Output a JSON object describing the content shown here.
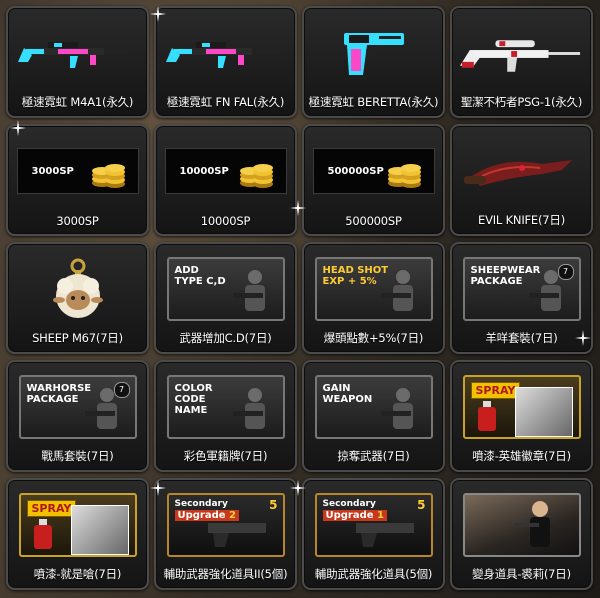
{
  "items": [
    {
      "label": "極速霓虹 M4A1(永久)",
      "art": "rifle-neon"
    },
    {
      "label": "極速霓虹 FN FAL(永久)",
      "art": "rifle-neon"
    },
    {
      "label": "極速霓虹 BERETTA(永久)",
      "art": "pistol-neon"
    },
    {
      "label": "聖潔不朽者PSG-1(永久)",
      "art": "sniper-white"
    },
    {
      "label": "3000SP",
      "art": "sp",
      "amount": "3000SP"
    },
    {
      "label": "10000SP",
      "art": "sp",
      "amount": "10000SP"
    },
    {
      "label": "500000SP",
      "art": "sp",
      "amount": "500000SP"
    },
    {
      "label": "EVIL KNIFE(7日)",
      "art": "knife"
    },
    {
      "label": "SHEEP M67(7日)",
      "art": "sheep"
    },
    {
      "label": "武器增加C.D(7日)",
      "art": "promo",
      "promo_text": "ADD\nTYPE C,D",
      "promo_color": "#ffffff"
    },
    {
      "label": "爆頭點數+5%(7日)",
      "art": "promo",
      "promo_text": "HEAD SHOT\nEXP + 5%",
      "promo_color": "#ffcc33"
    },
    {
      "label": "羊咩套裝(7日)",
      "art": "promo",
      "promo_text": "SHEEPWEAR\nPACKAGE",
      "promo_color": "#ffffff",
      "badge": "7"
    },
    {
      "label": "戰馬套裝(7日)",
      "art": "promo",
      "promo_text": "WARHORSE\nPACKAGE",
      "promo_color": "#ffffff",
      "badge": "7"
    },
    {
      "label": "彩色軍籍牌(7日)",
      "art": "promo",
      "promo_text": "COLOR\nCODE\nNAME",
      "promo_color": "#ffffff"
    },
    {
      "label": "掠奪武器(7日)",
      "art": "promo",
      "promo_text": "GAIN\nWEAPON",
      "promo_color": "#ffffff"
    },
    {
      "label": "噴漆-英雄徽章(7日)",
      "art": "spray",
      "promo_text": "SPRAY"
    },
    {
      "label": "噴漆-就是嗆(7日)",
      "art": "spray",
      "promo_text": "SPRAY"
    },
    {
      "label": "輔助武器強化道具II(5個)",
      "art": "upgrade",
      "promo_text": "Secondary\nUpgrade",
      "level": "2",
      "badge": "5"
    },
    {
      "label": "輔助武器強化道具(5個)",
      "art": "upgrade",
      "promo_text": "Secondary\nUpgrade",
      "level": "1",
      "badge": "5"
    },
    {
      "label": "變身道具-裘莉(7日)",
      "art": "photo"
    }
  ]
}
